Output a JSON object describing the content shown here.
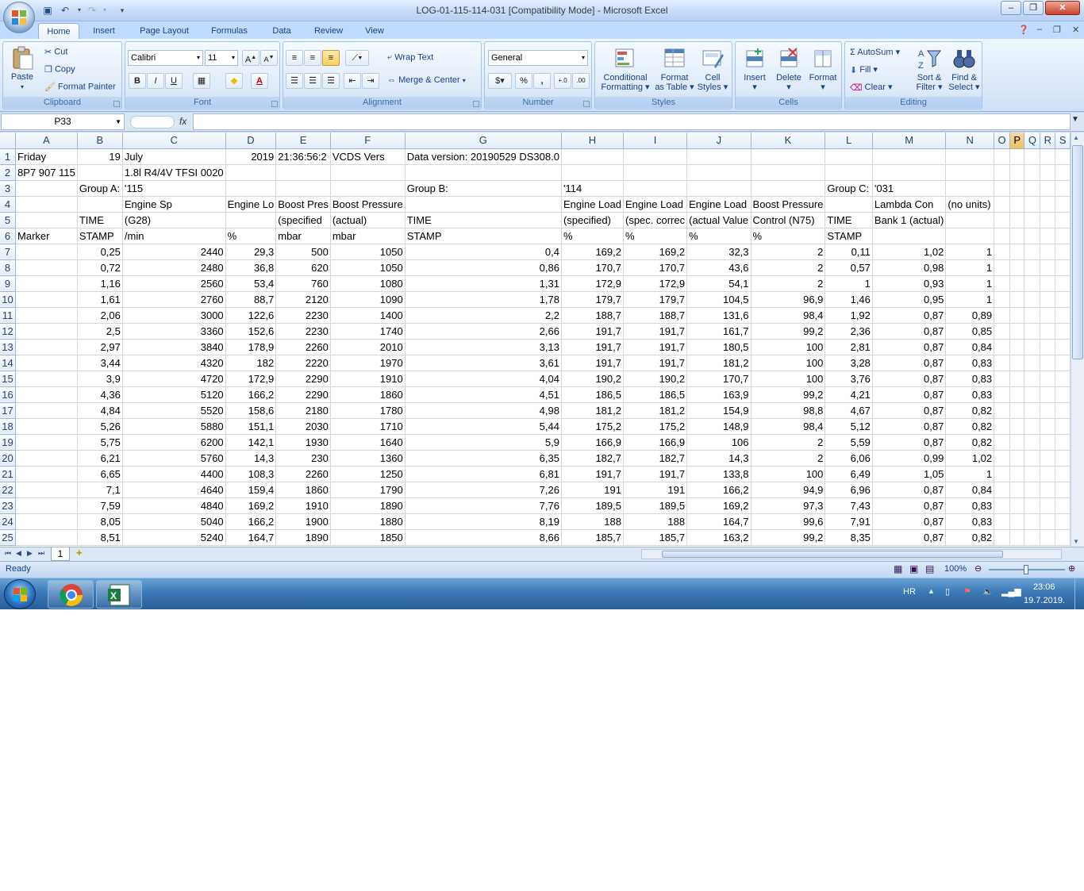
{
  "window": {
    "title": "LOG-01-115-114-031  [Compatibility Mode] - Microsoft Excel"
  },
  "tabs": [
    "Home",
    "Insert",
    "Page Layout",
    "Formulas",
    "Data",
    "Review",
    "View"
  ],
  "clipboard": {
    "paste": "Paste",
    "cut": "Cut",
    "copy": "Copy",
    "format_painter": "Format Painter",
    "label": "Clipboard"
  },
  "font": {
    "name": "Calibri",
    "size": "11",
    "bold": "B",
    "italic": "I",
    "underline": "U",
    "label": "Font"
  },
  "alignment": {
    "wrap": "Wrap Text",
    "merge": "Merge & Center",
    "label": "Alignment"
  },
  "number": {
    "format": "General",
    "percent": "%",
    "comma": ",",
    "label": "Number"
  },
  "styles": {
    "conditional": "Conditional",
    "conditional2": "Formatting",
    "format_table": "Format",
    "format_table2": "as Table",
    "cell_styles": "Cell",
    "cell_styles2": "Styles",
    "label": "Styles"
  },
  "cells": {
    "insert": "Insert",
    "delete": "Delete",
    "format": "Format",
    "label": "Cells"
  },
  "editing": {
    "autosum": "AutoSum",
    "fill": "Fill",
    "clear": "Clear",
    "sort": "Sort &",
    "sort2": "Filter",
    "find": "Find &",
    "find2": "Select",
    "label": "Editing"
  },
  "formula_bar": {
    "name_box": "P33",
    "fx": "fx",
    "value": ""
  },
  "columns": [
    "A",
    "B",
    "C",
    "D",
    "E",
    "F",
    "G",
    "H",
    "I",
    "J",
    "K",
    "L",
    "M",
    "N",
    "O",
    "P",
    "Q",
    "R",
    "S"
  ],
  "selected_column": "P",
  "rows": [
    [
      "Friday",
      "19",
      "July",
      "2019",
      "21:36:56:2",
      "VCDS Vers",
      "Data version: 20190529 DS308.0",
      "",
      "",
      "",
      "",
      "",
      "",
      "",
      "",
      "",
      "",
      "",
      ""
    ],
    [
      "8P7 907 115",
      "",
      "1.8l R4/4V TFSI    0020",
      "",
      "",
      "",
      "",
      "",
      "",
      "",
      "",
      "",
      "",
      "",
      "",
      "",
      "",
      "",
      ""
    ],
    [
      "",
      "Group A:",
      "'115",
      "",
      "",
      "",
      "Group B:",
      "'114",
      "",
      "",
      "",
      "Group C:",
      "'031",
      "",
      "",
      "",
      "",
      "",
      ""
    ],
    [
      "",
      "",
      "Engine Sp",
      "Engine Lo",
      "Boost Pres",
      "Boost Pressure",
      "",
      "Engine Load",
      "Engine Load",
      "Engine Load",
      "Boost Pressure",
      "",
      "Lambda Con",
      "(no units)",
      "",
      "",
      "",
      "",
      ""
    ],
    [
      "",
      "TIME",
      "(G28)",
      "",
      "(specified",
      "(actual)",
      "TIME",
      "(specified)",
      "(spec. correc",
      "(actual Value",
      "Control (N75)",
      "TIME",
      "Bank 1 (actual)",
      "",
      "",
      "",
      "",
      "",
      ""
    ],
    [
      "Marker",
      "STAMP",
      "/min",
      "%",
      "mbar",
      "mbar",
      "STAMP",
      "%",
      "%",
      "%",
      "%",
      "STAMP",
      "",
      "",
      "",
      "",
      "",
      "",
      ""
    ],
    [
      "",
      "0,25",
      "2440",
      "29,3",
      "500",
      "1050",
      "0,4",
      "169,2",
      "169,2",
      "32,3",
      "2",
      "0,11",
      "1,02",
      "1",
      "",
      "",
      "",
      "",
      ""
    ],
    [
      "",
      "0,72",
      "2480",
      "36,8",
      "620",
      "1050",
      "0,86",
      "170,7",
      "170,7",
      "43,6",
      "2",
      "0,57",
      "0,98",
      "1",
      "",
      "",
      "",
      "",
      ""
    ],
    [
      "",
      "1,16",
      "2560",
      "53,4",
      "760",
      "1080",
      "1,31",
      "172,9",
      "172,9",
      "54,1",
      "2",
      "1",
      "0,93",
      "1",
      "",
      "",
      "",
      "",
      ""
    ],
    [
      "",
      "1,61",
      "2760",
      "88,7",
      "2120",
      "1090",
      "1,78",
      "179,7",
      "179,7",
      "104,5",
      "96,9",
      "1,46",
      "0,95",
      "1",
      "",
      "",
      "",
      "",
      ""
    ],
    [
      "",
      "2,06",
      "3000",
      "122,6",
      "2230",
      "1400",
      "2,2",
      "188,7",
      "188,7",
      "131,6",
      "98,4",
      "1,92",
      "0,87",
      "0,89",
      "",
      "",
      "",
      "",
      ""
    ],
    [
      "",
      "2,5",
      "3360",
      "152,6",
      "2230",
      "1740",
      "2,66",
      "191,7",
      "191,7",
      "161,7",
      "99,2",
      "2,36",
      "0,87",
      "0,85",
      "",
      "",
      "",
      "",
      ""
    ],
    [
      "",
      "2,97",
      "3840",
      "178,9",
      "2260",
      "2010",
      "3,13",
      "191,7",
      "191,7",
      "180,5",
      "100",
      "2,81",
      "0,87",
      "0,84",
      "",
      "",
      "",
      "",
      ""
    ],
    [
      "",
      "3,44",
      "4320",
      "182",
      "2220",
      "1970",
      "3,61",
      "191,7",
      "191,7",
      "181,2",
      "100",
      "3,28",
      "0,87",
      "0,83",
      "",
      "",
      "",
      "",
      ""
    ],
    [
      "",
      "3,9",
      "4720",
      "172,9",
      "2290",
      "1910",
      "4,04",
      "190,2",
      "190,2",
      "170,7",
      "100",
      "3,76",
      "0,87",
      "0,83",
      "",
      "",
      "",
      "",
      ""
    ],
    [
      "",
      "4,36",
      "5120",
      "166,2",
      "2290",
      "1860",
      "4,51",
      "186,5",
      "186,5",
      "163,9",
      "99,2",
      "4,21",
      "0,87",
      "0,83",
      "",
      "",
      "",
      "",
      ""
    ],
    [
      "",
      "4,84",
      "5520",
      "158,6",
      "2180",
      "1780",
      "4,98",
      "181,2",
      "181,2",
      "154,9",
      "98,8",
      "4,67",
      "0,87",
      "0,82",
      "",
      "",
      "",
      "",
      ""
    ],
    [
      "",
      "5,26",
      "5880",
      "151,1",
      "2030",
      "1710",
      "5,44",
      "175,2",
      "175,2",
      "148,9",
      "98,4",
      "5,12",
      "0,87",
      "0,82",
      "",
      "",
      "",
      "",
      ""
    ],
    [
      "",
      "5,75",
      "6200",
      "142,1",
      "1930",
      "1640",
      "5,9",
      "166,9",
      "166,9",
      "106",
      "2",
      "5,59",
      "0,87",
      "0,82",
      "",
      "",
      "",
      "",
      ""
    ],
    [
      "",
      "6,21",
      "5760",
      "14,3",
      "230",
      "1360",
      "6,35",
      "182,7",
      "182,7",
      "14,3",
      "2",
      "6,06",
      "0,99",
      "1,02",
      "",
      "",
      "",
      "",
      ""
    ],
    [
      "",
      "6,65",
      "4400",
      "108,3",
      "2260",
      "1250",
      "6,81",
      "191,7",
      "191,7",
      "133,8",
      "100",
      "6,49",
      "1,05",
      "1",
      "",
      "",
      "",
      "",
      ""
    ],
    [
      "",
      "7,1",
      "4640",
      "159,4",
      "1860",
      "1790",
      "7,26",
      "191",
      "191",
      "166,2",
      "94,9",
      "6,96",
      "0,87",
      "0,84",
      "",
      "",
      "",
      "",
      ""
    ],
    [
      "",
      "7,59",
      "4840",
      "169,2",
      "1910",
      "1890",
      "7,76",
      "189,5",
      "189,5",
      "169,2",
      "97,3",
      "7,43",
      "0,87",
      "0,83",
      "",
      "",
      "",
      "",
      ""
    ],
    [
      "",
      "8,05",
      "5040",
      "166,2",
      "1900",
      "1880",
      "8,19",
      "188",
      "188",
      "164,7",
      "99,6",
      "7,91",
      "0,87",
      "0,83",
      "",
      "",
      "",
      "",
      ""
    ],
    [
      "",
      "8,51",
      "5240",
      "164,7",
      "1890",
      "1850",
      "8,66",
      "185,7",
      "185,7",
      "163,2",
      "99,2",
      "8,35",
      "0,87",
      "0,82",
      "",
      "",
      "",
      "",
      ""
    ]
  ],
  "sheet_tab": "1",
  "status": {
    "ready": "Ready",
    "zoom": "100%"
  },
  "taskbar": {
    "lang": "HR",
    "time": "23:06",
    "date": "19.7.2019."
  }
}
